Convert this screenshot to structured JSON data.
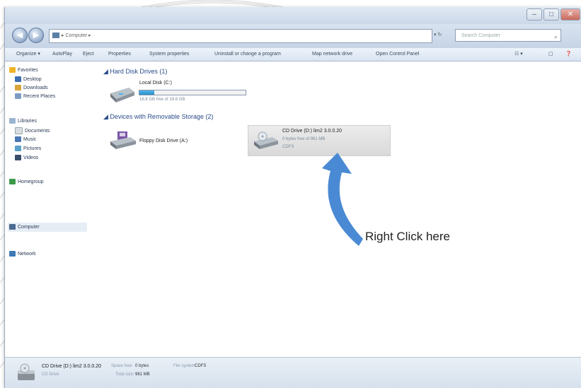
{
  "window": {
    "min_glyph": "–",
    "max_glyph": "□",
    "close_glyph": "✕"
  },
  "address": {
    "back_glyph": "◀",
    "forward_glyph": "▶",
    "path": "▸ Computer ▸",
    "refresh": "▾ ↻",
    "search_placeholder": "Search Computer",
    "search_glyph": "⌕"
  },
  "toolbar": {
    "items": [
      "Organize ▾",
      "AutoPlay",
      "Eject",
      "Properties",
      "System properties",
      "Uninstall or change a program",
      "Map network drive",
      "Open Control Panel"
    ]
  },
  "sidebar": {
    "favorites": "Favorites",
    "desktop": "Desktop",
    "downloads": "Downloads",
    "recent": "Recent Places",
    "libraries": "Libraries",
    "documents": "Documents",
    "music": "Music",
    "pictures": "Pictures",
    "videos": "Videos",
    "homegroup": "Homegroup",
    "computer": "Computer",
    "network": "Network"
  },
  "main": {
    "hdd_header": "Hard Disk Drives (1)",
    "local_disk_name": "Local Disk (C:)",
    "local_disk_free": "16.8 GB free of 19.6 GB",
    "local_disk_used_fraction": 0.14,
    "removable_header": "Devices with Removable Storage (2)",
    "floppy_name": "Floppy Disk Drive (A:)",
    "cd_name": "CD Drive (D:) lim2 3.0.0.20",
    "cd_free": "0 bytes free of 961 MB",
    "cd_fs": "CDFS"
  },
  "annotation": {
    "text": "Right Click here",
    "color": "#4a8ad4"
  },
  "status": {
    "name": "CD Drive (D:) lim2 3.0.0.20",
    "type": "CD Drive",
    "space_free_label": "Space free:",
    "space_free": "0 bytes",
    "total_size_label": "Total size:",
    "total_size": "961 MB",
    "fs_label": "File system:",
    "fs": "CDFS"
  }
}
